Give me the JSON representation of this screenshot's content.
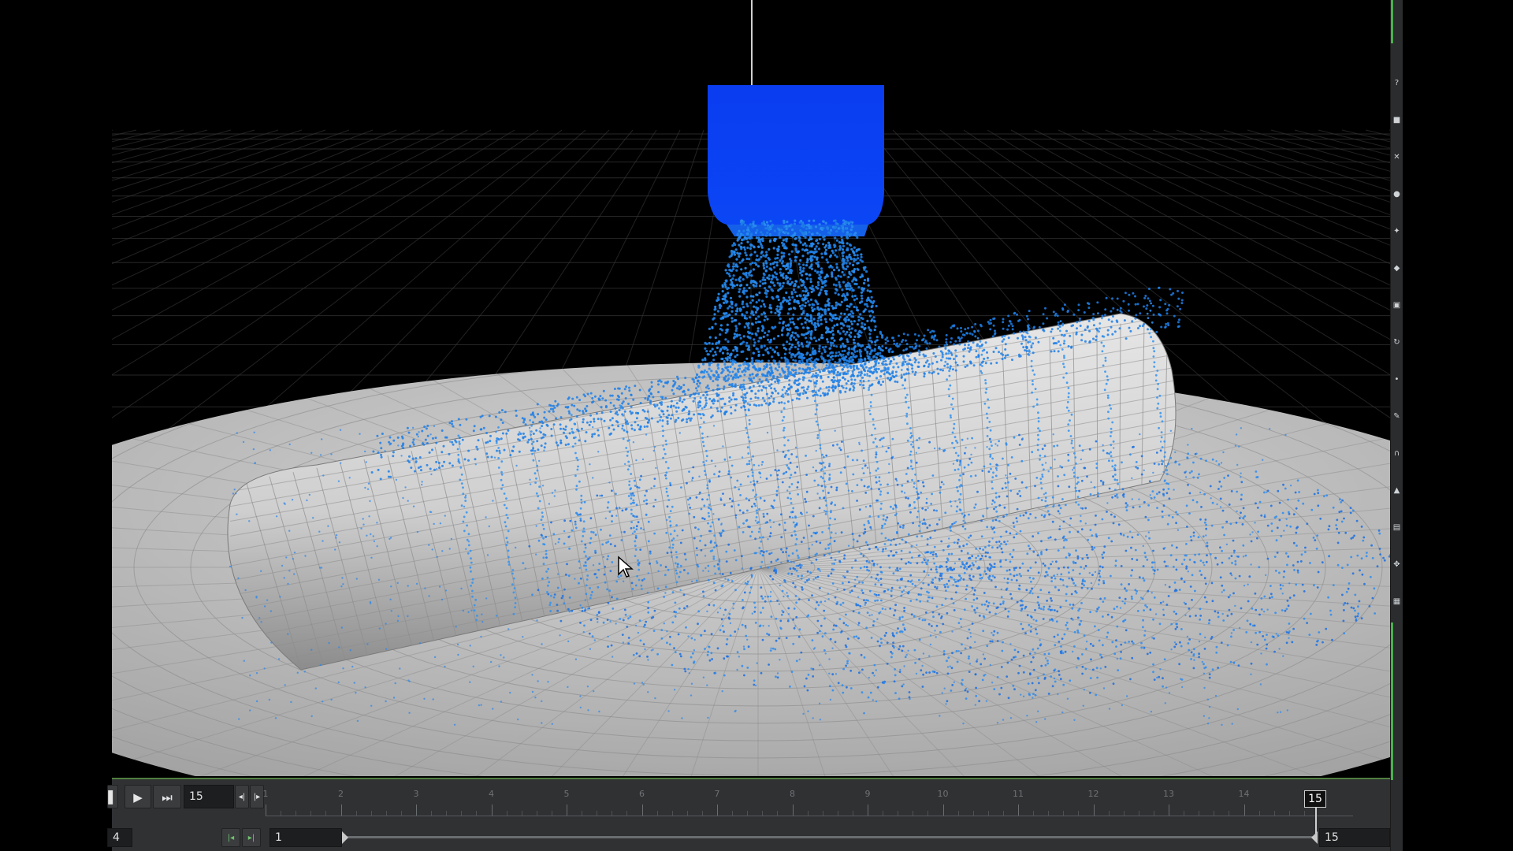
{
  "scene": {
    "particle_color": "#1e7fe6",
    "emitter_color": "#0a3cf0",
    "collider_color": "#c4c4c4",
    "ground_color": "#b8b8b8",
    "grid_color": "#3a3a3a",
    "background_color": "#000000"
  },
  "playbar": {
    "buttons": [
      {
        "name": "stop-button",
        "icon": "stop-icon"
      },
      {
        "name": "play-button",
        "icon": "play-icon"
      },
      {
        "name": "jump-end-button",
        "icon": "skip-to-end-icon"
      }
    ],
    "current_frame_value": "15",
    "step_back_icon": "step-back-icon",
    "step_forward_icon": "step-forward-icon",
    "frame_labels": [
      "1",
      "2",
      "3",
      "4",
      "5",
      "6",
      "7",
      "8",
      "9",
      "10",
      "11",
      "12",
      "13",
      "14"
    ],
    "current_frame_marker": "15",
    "range_start_left": "4",
    "range_start_value": "1",
    "range_end_value": "15",
    "range_start_icon": "range-start-icon",
    "range_end_icon": "range-end-icon"
  },
  "shelf": {
    "icons": [
      "help-icon",
      "lock-icon",
      "close-icon",
      "sphere-icon",
      "light-icon",
      "snap-icon",
      "camera-icon",
      "rotate-icon",
      "dot-icon",
      "pen-icon",
      "magnet-icon",
      "measure-icon",
      "display-icon",
      "handle-icon",
      "grid-icon"
    ]
  }
}
